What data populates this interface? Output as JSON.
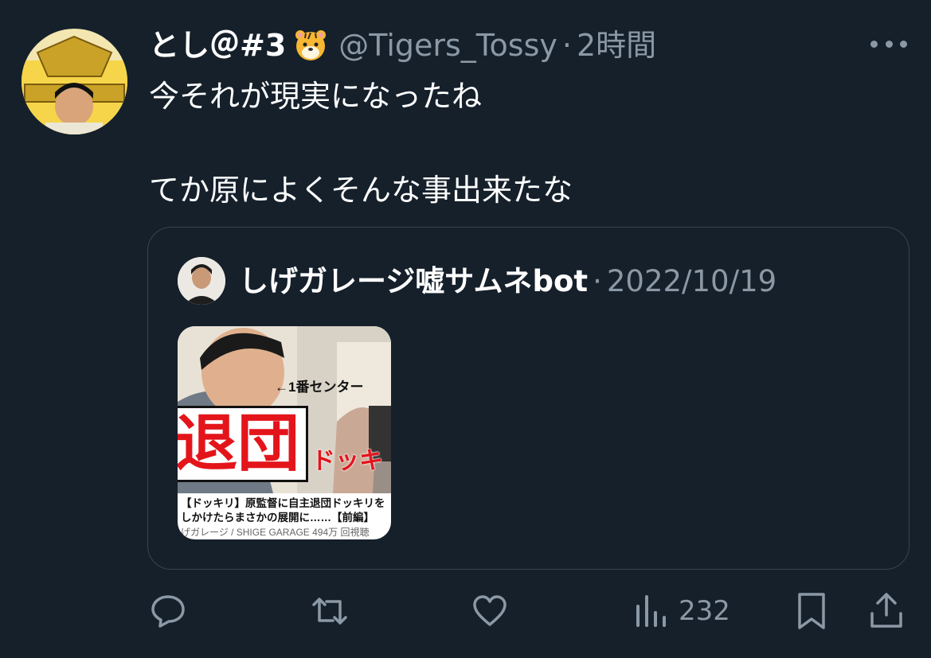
{
  "tweet": {
    "display_name": "とし＠#3",
    "name_emoji": "tiger-face",
    "handle": "@Tigers_Tossy",
    "separator": "·",
    "time": "2時間",
    "text_line1": "今それが現実になったね",
    "text_line2": "てか原によくそんな事出来たな"
  },
  "quote": {
    "display_name": "しげガレージ嘘サムネbot",
    "separator": "·",
    "date": "2022/10/19",
    "thumbnail": {
      "arrow_label": "←1番センター",
      "big_text": "退団",
      "sub_text": "ドッキ",
      "caption_line1": "【ドッキリ】原監督に自主退団ドッキリを",
      "caption_line2": "しかけたらまさかの展開に……【前編】",
      "caption_line3": "げガレージ / SHIGE GARAGE 494万 回視聴"
    }
  },
  "actions": {
    "views": "232"
  },
  "colors": {
    "background": "#15202b",
    "text": "#ffffff",
    "secondary": "#8b98a5",
    "border": "#38444d"
  }
}
